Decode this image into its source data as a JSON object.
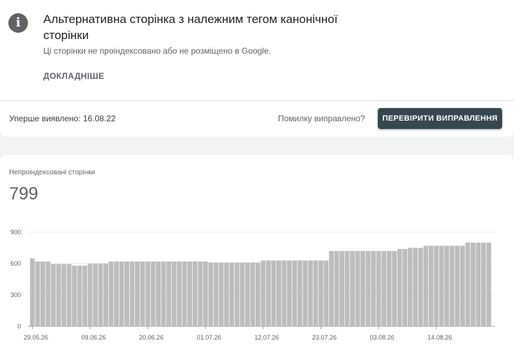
{
  "issue": {
    "icon": "info-icon",
    "title": "Альтернативна сторінка з належним тегом канонічної сторінки",
    "description": "Ці сторінки не проіндексовано або не розміщено в Google.",
    "learn_more": "ДОКЛАДНІШЕ"
  },
  "status": {
    "first_detected": "Уперше виявлено: 16.08.22",
    "fixed_question": "Помилку виправлено?",
    "validate_button": "ПЕРЕВІРИТИ ВИПРАВЛЕННЯ"
  },
  "metric": {
    "label": "Непроіндексовані сторінки",
    "value": "799"
  },
  "colors": {
    "bar": "#bdbdbd",
    "button": "#37474f"
  },
  "chart_data": {
    "type": "bar",
    "y_ticks": [
      "0",
      "300",
      "600",
      "900"
    ],
    "ylim": [
      0,
      900
    ],
    "grid": true,
    "x_tick_labels": [
      "29.05.26",
      "09.06.26",
      "20.06.26",
      "01.07.26",
      "12.07.26",
      "23.07.26",
      "03.08.26",
      "14.08.26"
    ],
    "x_tick_indices": [
      0,
      11,
      22,
      33,
      44,
      55,
      66,
      77
    ],
    "values": [
      650,
      620,
      620,
      620,
      595,
      595,
      595,
      595,
      580,
      580,
      580,
      600,
      600,
      600,
      600,
      620,
      620,
      620,
      620,
      620,
      620,
      620,
      620,
      620,
      620,
      620,
      620,
      620,
      620,
      620,
      620,
      620,
      620,
      620,
      610,
      610,
      610,
      610,
      610,
      610,
      610,
      610,
      610,
      610,
      630,
      630,
      630,
      630,
      630,
      630,
      630,
      630,
      630,
      630,
      630,
      630,
      630,
      720,
      720,
      720,
      720,
      720,
      720,
      720,
      720,
      720,
      720,
      720,
      720,
      720,
      740,
      740,
      750,
      750,
      750,
      770,
      770,
      770,
      770,
      770,
      770,
      770,
      770,
      800,
      800,
      800,
      800,
      800
    ]
  }
}
